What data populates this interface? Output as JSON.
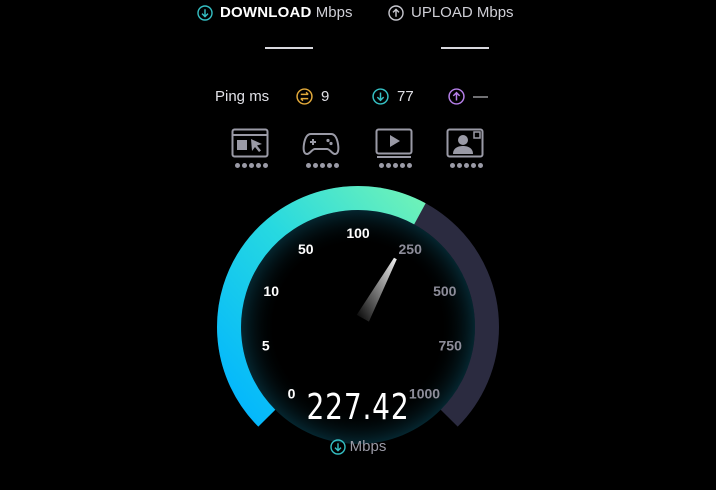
{
  "header": {
    "download": {
      "strong": "DOWNLOAD",
      "unit": "Mbps",
      "value": "—",
      "icon": "download-arrow-icon",
      "color": "#35c0c4"
    },
    "upload": {
      "strong": "",
      "label": "UPLOAD Mbps",
      "value": "—",
      "icon": "upload-arrow-icon",
      "color": "#bfbfc8"
    }
  },
  "ping": {
    "label": "Ping ms",
    "idle": {
      "value": "9",
      "icon": "ping-idle-icon",
      "color": "#e2a93a"
    },
    "download": {
      "value": "77",
      "icon": "ping-download-icon",
      "color": "#35c0c4"
    },
    "upload": {
      "value": "—",
      "icon": "ping-upload-icon",
      "color": "#b57fe8"
    }
  },
  "activities": [
    {
      "name": "browsing",
      "icon": "web-browsing-icon",
      "rating": 1
    },
    {
      "name": "gaming",
      "icon": "gamepad-icon",
      "rating": 1
    },
    {
      "name": "streaming",
      "icon": "video-play-icon",
      "rating": 1
    },
    {
      "name": "video-call",
      "icon": "video-call-icon",
      "rating": 1
    }
  ],
  "gauge": {
    "ticks": [
      "0",
      "5",
      "10",
      "50",
      "100",
      "250",
      "500",
      "750",
      "1000"
    ],
    "tick_values": [
      0,
      5,
      10,
      50,
      100,
      250,
      500,
      750,
      1000
    ],
    "speed": 227.42,
    "speed_text": "227.42",
    "unit": "Mbps",
    "colors": {
      "start": "#00b4ff",
      "mid": "#27d9e0",
      "end": "#6ef2b8",
      "track": "#2b2b40"
    }
  }
}
